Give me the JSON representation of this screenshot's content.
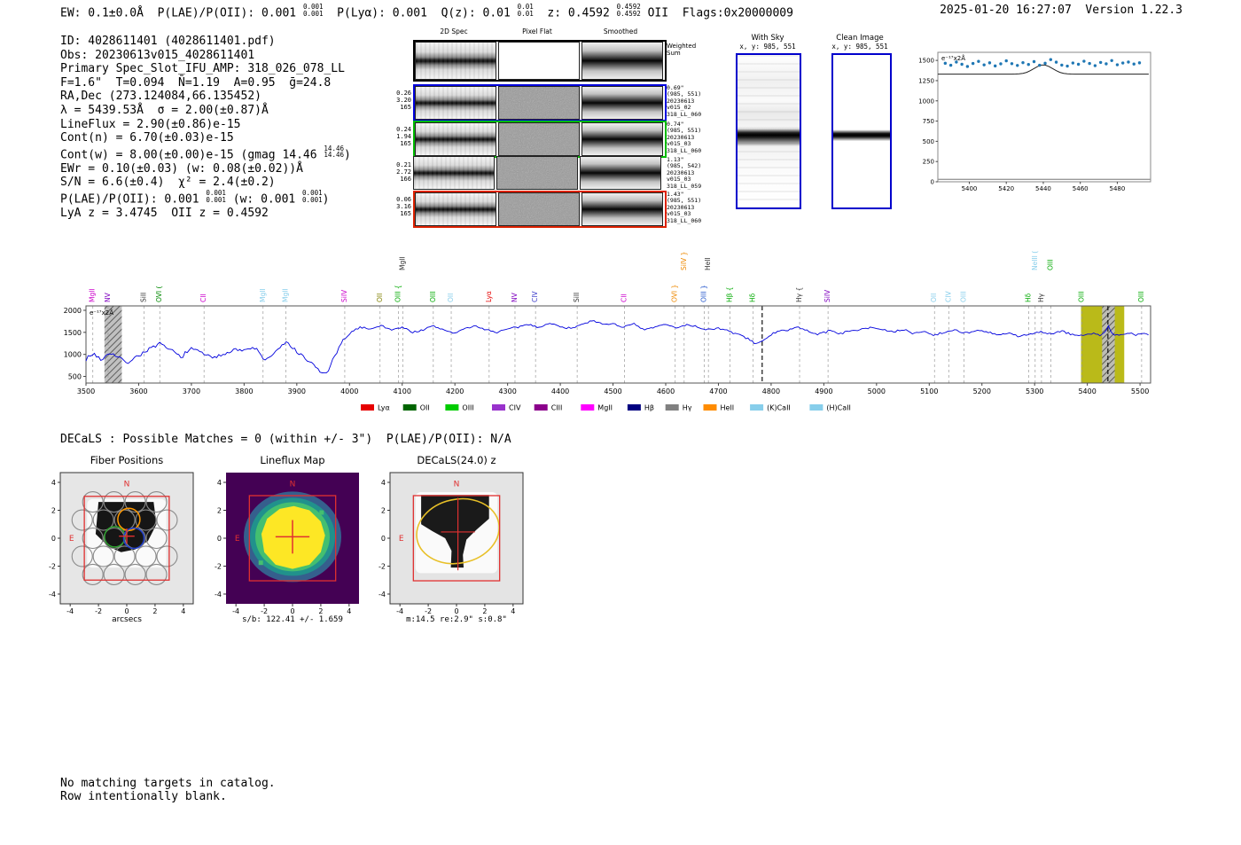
{
  "header": {
    "segments": [
      {
        "t": "EW: 0.1±0.0Å  P(LAE)/P(OII): 0.001 "
      },
      {
        "hi": "0.001",
        "lo": "0.001"
      },
      {
        "t": "  P(Lyα): 0.001  Q(z): 0.01 "
      },
      {
        "hi": "0.01",
        "lo": "0.01"
      },
      {
        "t": "  z: 0.4592 "
      },
      {
        "hi": "0.4592",
        "lo": "0.4592"
      },
      {
        "t": " OII  Flags:0x20000009"
      }
    ],
    "right": "2025-01-20 16:27:07  Version 1.22.3"
  },
  "info": {
    "lines": [
      [
        {
          "t": "ID: 4028611401 (4028611401.pdf)"
        }
      ],
      [
        {
          "t": "Obs: 20230613v015_4028611401"
        }
      ],
      [
        {
          "t": "Primary Spec_Slot_IFU_AMP: 318_026_078_LL"
        }
      ],
      [
        {
          "t": "F=1.6\"  T=0.094  N̄=1.19  A=0.95  ḡ=24.8"
        }
      ],
      [
        {
          "t": "RA,Dec (273.124084,66.135452)"
        }
      ],
      [
        {
          "t": "λ = 5439.53Å  σ = 2.00(±0.87)Å"
        }
      ],
      [
        {
          "t": "LineFlux = 2.90(±0.86)e-15"
        }
      ],
      [
        {
          "t": "Cont(n) = 6.70(±0.03)e-15"
        }
      ],
      [
        {
          "t": "Cont(w) = 8.00(±0.00)e-15 (gmag 14.46 "
        },
        {
          "hi": "14.46",
          "lo": "14.46"
        },
        {
          "t": ")"
        }
      ],
      [
        {
          "t": "EWr = 0.10(±0.03) (w: 0.08(±0.02))Å"
        }
      ],
      [
        {
          "t": "S/N = 6.6(±0.4)  χ² = 2.4(±0.2)"
        }
      ],
      [
        {
          "t": "P(LAE)/P(OII): 0.001 "
        },
        {
          "hi": "0.001",
          "lo": "0.001"
        },
        {
          "t": " (w: 0.001 "
        },
        {
          "hi": "0.001",
          "lo": "0.001"
        },
        {
          "t": ")"
        }
      ],
      [
        {
          "t": "LyA z = 3.4745  OII z = 0.4592"
        }
      ]
    ]
  },
  "spec2d": {
    "col_titles": [
      "2D Spec",
      "Pixel Flat",
      "Smoothed"
    ],
    "weighted_label": "Weighted\nSum",
    "rows": [
      {
        "left": [],
        "border": "#000000",
        "right": []
      },
      {
        "left": [
          "0.26",
          "3.20",
          "165"
        ],
        "border": "#0000dd",
        "right": [
          "0.69\"",
          "(985, 551)",
          "20230613",
          "v015_02",
          "318_LL_060"
        ]
      },
      {
        "left": [
          "0.24",
          "1.94",
          "165"
        ],
        "border": "#00bb00",
        "right": [
          "0.74\"",
          "(985, 551)",
          "20230613",
          "v015_03",
          "318_LL_060"
        ]
      },
      {
        "left": [
          "0.21",
          "2.72",
          "166"
        ],
        "border": "none",
        "right": [
          "1.13\"",
          "(985, 542)",
          "20230613",
          "v015_03",
          "318_LL_059"
        ]
      },
      {
        "left": [
          "0.06",
          "3.16",
          "165"
        ],
        "border": "#dd2200",
        "right": [
          "1.43\"",
          "(985, 551)",
          "20230613",
          "v015_03",
          "318_LL_060"
        ]
      }
    ]
  },
  "cutouts2d": {
    "with_sky": {
      "title": "With Sky",
      "subtitle": "x, y: 985, 551"
    },
    "clean": {
      "title": "Clean Image",
      "subtitle": "x, y: 985, 551"
    }
  },
  "chart_data": [
    {
      "type": "line",
      "name": "full-spectrum",
      "annotation": "e⁻¹⁷x2Å",
      "xlim": [
        3500,
        5520
      ],
      "ylim": [
        350,
        2100
      ],
      "xticks": [
        3500,
        3600,
        3700,
        3800,
        3900,
        4000,
        4100,
        4200,
        4300,
        4400,
        4500,
        4600,
        4700,
        4800,
        4900,
        5000,
        5100,
        5200,
        5300,
        5400,
        5500
      ],
      "yticks": [
        500,
        1000,
        1500,
        2000
      ],
      "line_color": "#0000dd",
      "anchors": [
        [
          3500,
          900
        ],
        [
          3515,
          1020
        ],
        [
          3530,
          870
        ],
        [
          3545,
          1060
        ],
        [
          3560,
          930
        ],
        [
          3580,
          820
        ],
        [
          3600,
          980
        ],
        [
          3620,
          1120
        ],
        [
          3640,
          1230
        ],
        [
          3660,
          1100
        ],
        [
          3680,
          950
        ],
        [
          3700,
          1120
        ],
        [
          3720,
          1050
        ],
        [
          3740,
          900
        ],
        [
          3760,
          1000
        ],
        [
          3780,
          1130
        ],
        [
          3800,
          1080
        ],
        [
          3820,
          1160
        ],
        [
          3840,
          860
        ],
        [
          3860,
          1050
        ],
        [
          3880,
          1280
        ],
        [
          3900,
          1060
        ],
        [
          3915,
          900
        ],
        [
          3930,
          780
        ],
        [
          3945,
          600
        ],
        [
          3955,
          540
        ],
        [
          3970,
          900
        ],
        [
          3985,
          1250
        ],
        [
          4000,
          1480
        ],
        [
          4020,
          1620
        ],
        [
          4040,
          1580
        ],
        [
          4060,
          1650
        ],
        [
          4080,
          1560
        ],
        [
          4100,
          1620
        ],
        [
          4120,
          1500
        ],
        [
          4140,
          1560
        ],
        [
          4160,
          1640
        ],
        [
          4180,
          1550
        ],
        [
          4200,
          1480
        ],
        [
          4220,
          1590
        ],
        [
          4240,
          1640
        ],
        [
          4260,
          1560
        ],
        [
          4280,
          1500
        ],
        [
          4300,
          1570
        ],
        [
          4320,
          1620
        ],
        [
          4340,
          1680
        ],
        [
          4360,
          1620
        ],
        [
          4380,
          1700
        ],
        [
          4400,
          1640
        ],
        [
          4420,
          1580
        ],
        [
          4440,
          1700
        ],
        [
          4460,
          1750
        ],
        [
          4480,
          1680
        ],
        [
          4500,
          1700
        ],
        [
          4520,
          1620
        ],
        [
          4540,
          1680
        ],
        [
          4560,
          1550
        ],
        [
          4580,
          1620
        ],
        [
          4600,
          1680
        ],
        [
          4620,
          1600
        ],
        [
          4640,
          1680
        ],
        [
          4660,
          1620
        ],
        [
          4680,
          1560
        ],
        [
          4700,
          1600
        ],
        [
          4720,
          1520
        ],
        [
          4740,
          1450
        ],
        [
          4760,
          1320
        ],
        [
          4775,
          1230
        ],
        [
          4790,
          1380
        ],
        [
          4810,
          1500
        ],
        [
          4830,
          1560
        ],
        [
          4850,
          1620
        ],
        [
          4870,
          1520
        ],
        [
          4890,
          1460
        ],
        [
          4910,
          1540
        ],
        [
          4930,
          1480
        ],
        [
          4950,
          1520
        ],
        [
          4970,
          1580
        ],
        [
          4990,
          1620
        ],
        [
          5010,
          1560
        ],
        [
          5030,
          1500
        ],
        [
          5050,
          1560
        ],
        [
          5070,
          1480
        ],
        [
          5090,
          1520
        ],
        [
          5110,
          1440
        ],
        [
          5130,
          1500
        ],
        [
          5150,
          1560
        ],
        [
          5170,
          1480
        ],
        [
          5190,
          1540
        ],
        [
          5210,
          1500
        ],
        [
          5230,
          1440
        ],
        [
          5250,
          1480
        ],
        [
          5270,
          1400
        ],
        [
          5290,
          1460
        ],
        [
          5310,
          1520
        ],
        [
          5330,
          1460
        ],
        [
          5350,
          1520
        ],
        [
          5370,
          1460
        ],
        [
          5390,
          1420
        ],
        [
          5410,
          1480
        ],
        [
          5425,
          1440
        ],
        [
          5433,
          1500
        ],
        [
          5440,
          1640
        ],
        [
          5448,
          1460
        ],
        [
          5460,
          1420
        ],
        [
          5475,
          1480
        ],
        [
          5490,
          1440
        ],
        [
          5505,
          1470
        ],
        [
          5515,
          1450
        ]
      ],
      "bands": [
        {
          "x0": 3535,
          "x1": 3568,
          "type": "hatch"
        },
        {
          "x0": 5388,
          "x1": 5470,
          "type": "yellow"
        },
        {
          "x0": 5428,
          "x1": 5452,
          "type": "hatch"
        }
      ],
      "yellow_band_color": "#b3b300",
      "special_dashed": [
        4783,
        5439
      ],
      "line_labels": [
        {
          "x": 3513,
          "label": "MgII",
          "color": "#cc00cc"
        },
        {
          "x": 3542,
          "label": "NV",
          "color": "#7f00bf"
        },
        {
          "x": 3610,
          "label": "SiII",
          "color": "#333333"
        },
        {
          "x": 3640,
          "label": "OVI (",
          "color": "#008800"
        },
        {
          "x": 3724,
          "label": "CII",
          "color": "#cc00cc"
        },
        {
          "x": 3836,
          "label": "MgII",
          "color": "#87ceeb"
        },
        {
          "x": 3879,
          "label": "MgII",
          "color": "#87ceeb"
        },
        {
          "x": 3991,
          "label": "SiIV",
          "color": "#cc00cc"
        },
        {
          "x": 4058,
          "label": "OII",
          "color": "#808000"
        },
        {
          "x": 4093,
          "label": "OIII {",
          "color": "#00aa00"
        },
        {
          "x": 4101,
          "label": "MgII",
          "color": "#333333"
        },
        {
          "x": 4159,
          "label": "OIII",
          "color": "#00aa00"
        },
        {
          "x": 4193,
          "label": "OII",
          "color": "#87ceeb"
        },
        {
          "x": 4265,
          "label": "Lyα",
          "color": "#e60000"
        },
        {
          "x": 4314,
          "label": "NV",
          "color": "#7f00bf"
        },
        {
          "x": 4353,
          "label": "CIV",
          "color": "#4444cc"
        },
        {
          "x": 4432,
          "label": "SiII",
          "color": "#333333"
        },
        {
          "x": 4522,
          "label": "CII",
          "color": "#cc00cc"
        },
        {
          "x": 4618,
          "label": "OVI }",
          "color": "#ee8800"
        },
        {
          "x": 4635,
          "label": "SiIV }",
          "color": "#ee8800"
        },
        {
          "x": 4673,
          "label": "OIII }",
          "color": "#2255cc"
        },
        {
          "x": 4681,
          "label": "HeII",
          "color": "#333333"
        },
        {
          "x": 4722,
          "label": "Hβ {",
          "color": "#00aa00"
        },
        {
          "x": 4766,
          "label": "Hδ",
          "color": "#00aa00"
        },
        {
          "x": 4854,
          "label": "Hγ {",
          "color": "#333333"
        },
        {
          "x": 4908,
          "label": "SiIV",
          "color": "#7f00bf"
        },
        {
          "x": 5110,
          "label": "OII",
          "color": "#87ceeb"
        },
        {
          "x": 5137,
          "label": "CIV",
          "color": "#87ceeb"
        },
        {
          "x": 5166,
          "label": "OIII",
          "color": "#87ceeb"
        },
        {
          "x": 5289,
          "label": "Hδ",
          "color": "#00aa00"
        },
        {
          "x": 5301,
          "label": "NeIII (",
          "color": "#87ceeb"
        },
        {
          "x": 5313,
          "label": "Hγ",
          "color": "#333333"
        },
        {
          "x": 5331,
          "label": "OIII",
          "color": "#00aa00"
        },
        {
          "x": 5390,
          "label": "OIII",
          "color": "#00aa00"
        },
        {
          "x": 5503,
          "label": "OIII",
          "color": "#00aa00"
        }
      ],
      "legend": [
        {
          "label": "Lyα",
          "color": "#e60000"
        },
        {
          "label": "OII",
          "color": "#006400"
        },
        {
          "label": "OIII",
          "color": "#00cc00"
        },
        {
          "label": "CIV",
          "color": "#9932cc"
        },
        {
          "label": "CIII",
          "color": "#8b008b"
        },
        {
          "label": "MgII",
          "color": "#ff00ff"
        },
        {
          "label": "Hβ",
          "color": "#000080"
        },
        {
          "label": "Hγ",
          "color": "#808080"
        },
        {
          "label": "HeII",
          "color": "#ff8c00"
        },
        {
          "label": "(K)CaII",
          "color": "#87ceeb"
        },
        {
          "label": "(H)CaII",
          "color": "#87ceeb"
        }
      ]
    },
    {
      "type": "scatter+line",
      "name": "line-zoom",
      "annotation": "e⁻¹⁷x2Å",
      "xlim": [
        5383,
        5498
      ],
      "ylim": [
        0,
        1600
      ],
      "xticks": [
        5400,
        5420,
        5440,
        5460,
        5480
      ],
      "yticks": [
        0,
        250,
        500,
        750,
        1000,
        1250,
        1500
      ],
      "dot_color": "#1f77b4",
      "line_color": "#222222",
      "dots": {
        "x_start": 5387,
        "x_step": 3,
        "values": [
          1465,
          1440,
          1480,
          1452,
          1425,
          1462,
          1488,
          1445,
          1470,
          1432,
          1458,
          1495,
          1460,
          1438,
          1472,
          1450,
          1485,
          1440,
          1465,
          1510,
          1478,
          1442,
          1430,
          1468,
          1452,
          1490,
          1462,
          1435,
          1475,
          1458,
          1498,
          1446,
          1468,
          1480,
          1455,
          1470
        ]
      },
      "fit_line": {
        "baseline": 1330,
        "mu": 5440,
        "amplitude": 115,
        "sigma": 5
      },
      "zero_line_y": 30
    }
  ],
  "decals": {
    "header": "DECaLS : Possible Matches = 0 (within +/- 3\")  P(LAE)/P(OII): N/A",
    "panels": [
      {
        "title": "Fiber Positions",
        "caption": "arcsecs",
        "n": "N",
        "e": "E",
        "ticks": [
          -4,
          -2,
          0,
          2,
          4
        ]
      },
      {
        "title": "Lineflux Map",
        "caption": "s/b: 122.41 +/- 1.659",
        "n": "N",
        "e": "E",
        "ticks": [
          -4,
          -2,
          0,
          2,
          4
        ]
      },
      {
        "title": "DECaLS(24.0) z",
        "caption": "m:14.5 re:2.9\" s:0.8\"",
        "n": "N",
        "e": "E",
        "ticks": [
          -4,
          -2,
          0,
          2,
          4
        ]
      }
    ],
    "colors": {
      "marker": "#e03030",
      "orange_circle": "#ff9800",
      "green_circle": "#2e9e2e",
      "blue_circle": "#2040d0",
      "fiber_circle": "#8a8a8a",
      "ellipse": "#e8c028",
      "viridis": [
        "#440154",
        "#355f8d",
        "#21918c",
        "#44bf70",
        "#fde725"
      ]
    },
    "footer": [
      "No matching targets in catalog.",
      "Row intentionally blank."
    ]
  }
}
